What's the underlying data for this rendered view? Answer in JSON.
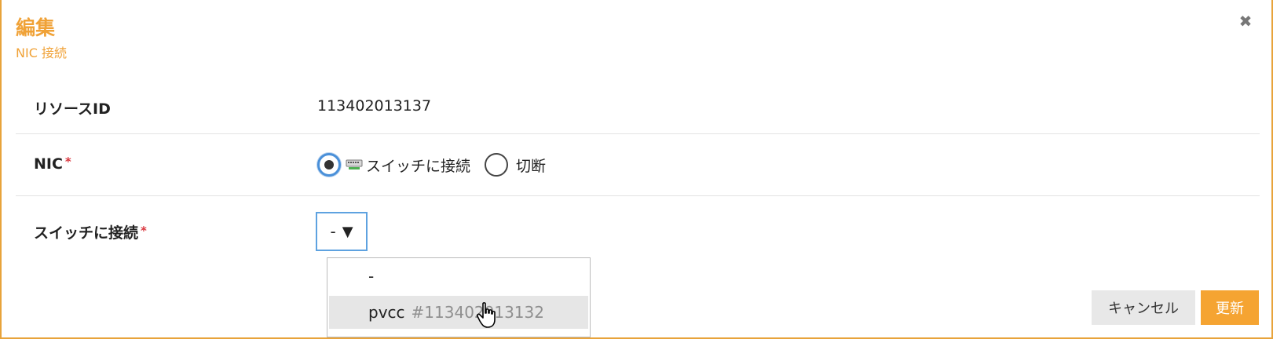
{
  "dialog": {
    "title": "編集",
    "subtitle": "NIC 接続",
    "close_icon": "close-icon"
  },
  "form": {
    "resource_id": {
      "label": "リソースID",
      "value": "113402013137"
    },
    "nic": {
      "label": "NIC",
      "required_mark": "*",
      "options": [
        {
          "label": "スイッチに接続",
          "icon": "switch-icon",
          "checked": true
        },
        {
          "label": "切断",
          "checked": false
        }
      ]
    },
    "switch": {
      "label": "スイッチに接続",
      "required_mark": "*",
      "selected": "-",
      "arrow": "▼",
      "dropdown": [
        {
          "name": "-",
          "id": ""
        },
        {
          "name": "pvcc",
          "id": "#113402013132"
        }
      ]
    }
  },
  "buttons": {
    "cancel": "キャンセル",
    "update": "更新"
  },
  "colors": {
    "accent": "#f0a237",
    "focus": "#5ea2e0",
    "required": "#d9363e"
  }
}
